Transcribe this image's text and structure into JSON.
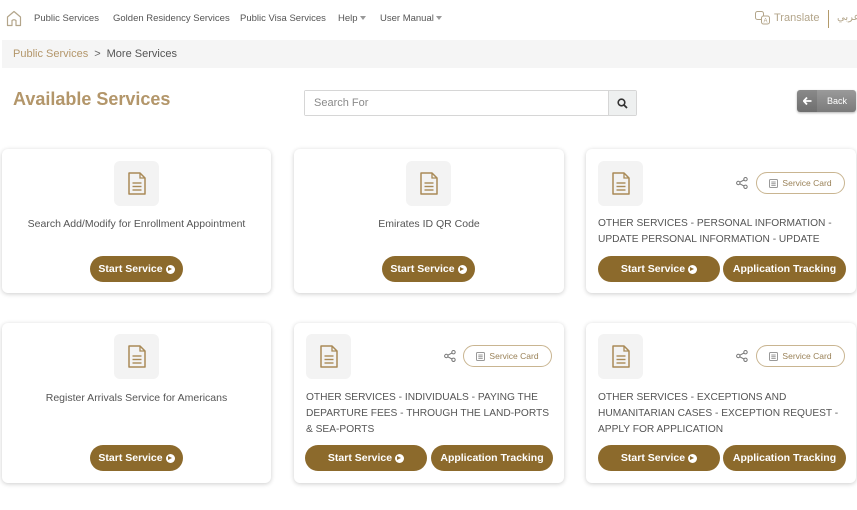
{
  "topnav": {
    "items": [
      {
        "label": "Public Services"
      },
      {
        "label": "Golden Residency Services"
      },
      {
        "label": "Public Visa Services"
      },
      {
        "label": "Help",
        "dropdown": true
      },
      {
        "label": "User Manual",
        "dropdown": true
      }
    ],
    "translate_label": "Translate",
    "language_label": "عربي"
  },
  "breadcrumb": {
    "parent": "Public Services",
    "separator": ">",
    "current": "More Services"
  },
  "page_title": "Available Services",
  "search": {
    "placeholder": "Search For",
    "value": ""
  },
  "back_label": "Back",
  "colors": {
    "accent": "#8c6a2c",
    "title": "#b3966a",
    "breadcrumb_link": "#b3966a"
  },
  "cards": [
    {
      "title": "Search Add/Modify for Enrollment Appointment",
      "start_label": "Start Service",
      "has_tracking": false
    },
    {
      "title": "Emirates ID QR Code",
      "start_label": "Start Service",
      "has_tracking": false
    },
    {
      "title": "OTHER SERVICES - PERSONAL INFORMATION - UPDATE PERSONAL INFORMATION - UPDATE",
      "start_label": "Start Service",
      "tracking_label": "Application Tracking",
      "service_card_label": "Service Card",
      "has_tracking": true
    },
    {
      "title": "Register Arrivals Service for Americans",
      "start_label": "Start Service",
      "has_tracking": false
    },
    {
      "title": "OTHER SERVICES - INDIVIDUALS - PAYING THE DEPARTURE FEES - THROUGH THE LAND-PORTS & SEA-PORTS",
      "start_label": "Start Service",
      "tracking_label": "Application Tracking",
      "service_card_label": "Service Card",
      "has_tracking": true
    },
    {
      "title": "OTHER SERVICES - EXCEPTIONS AND HUMANITARIAN CASES - EXCEPTION REQUEST - APPLY FOR APPLICATION",
      "start_label": "Start Service",
      "tracking_label": "Application Tracking",
      "service_card_label": "Service Card",
      "has_tracking": true
    }
  ]
}
